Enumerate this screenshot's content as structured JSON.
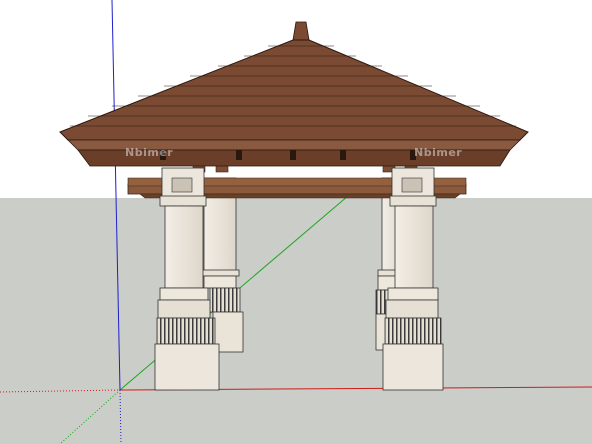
{
  "viewport": {
    "sky_color": "#ffffff",
    "ground_color": "#cbcdc9"
  },
  "axes": {
    "red_axis_color": "#d11a1a",
    "green_axis_color": "#1ea51e",
    "blue_axis_color": "#1f1fcc"
  },
  "model": {
    "roof_color": "#7a4a32",
    "roof_edge_color": "#8a5a40",
    "beam_color": "#8b5a3c",
    "column_color": "#ece6dc",
    "column_shadow_color": "#d9d2c6",
    "base_dark_color": "#555555"
  },
  "watermarks": [
    "Nbimer",
    "Nbimer"
  ]
}
